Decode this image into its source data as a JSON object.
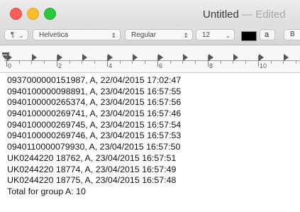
{
  "window": {
    "title": "Untitled",
    "title_suffix": "— Edited"
  },
  "toolbar": {
    "paragraph_label": "¶",
    "font_family": "Helvetica",
    "font_style": "Regular",
    "font_size": "12",
    "text_color": "#000000",
    "highlight_label": "a",
    "bold_label": "B"
  },
  "ruler": {
    "numbers": [
      "0",
      "2",
      "4",
      "6",
      "8",
      "10"
    ]
  },
  "document": {
    "lines": [
      "0937000000151987,  A,  22/04/2015 17:02:47",
      "0940100000098891,  A,  23/04/2015 16:57:55",
      "0940100000265374,  A,  23/04/2015 16:57:56",
      "0940100000269741,  A,  23/04/2015 16:57:46",
      "0940100000269745,  A,  23/04/2015 16:57:54",
      "0940100000269746,  A,  23/04/2015 16:57:53",
      "0940110000079930,  A,  23/04/2015 16:57:50",
      "UK0244220 18762,  A,  23/04/2015 16:57:51",
      "UK0244220 18774,  A,  23/04/2015 16:57:49",
      "UK0244220 18775,  A,  23/04/2015 16:57:48",
      "Total for group A: 10"
    ]
  }
}
